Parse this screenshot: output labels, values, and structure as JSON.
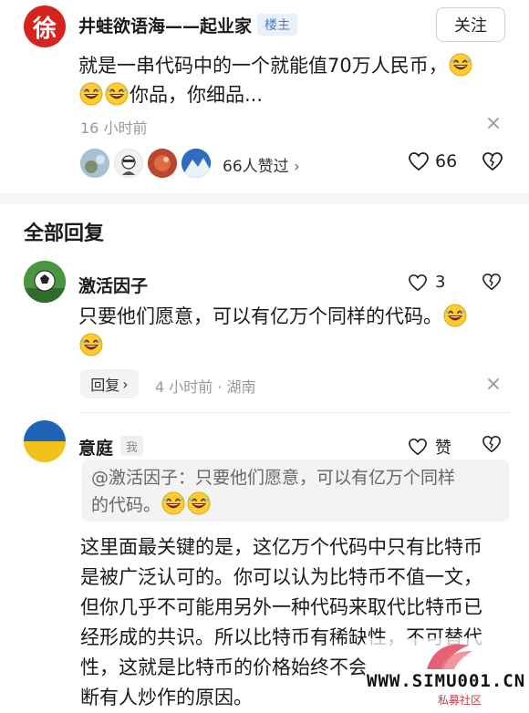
{
  "post": {
    "author": "井蛙欲语海——起业家",
    "avatar_char": "徐",
    "op_badge": "楼主",
    "follow_label": "关注",
    "text_line1": "就是一串代码中的一个就能值70万人民币，",
    "text_line2_suffix": "你品，你细品...",
    "time": "16 小时前",
    "likers_text": "66人赞过",
    "like_count": "66"
  },
  "section_title": "全部回复",
  "comments": [
    {
      "author": "激活因子",
      "like_count": "3",
      "text": "只要他们愿意，可以有亿万个同样的代码。",
      "reply_label": "回复",
      "meta": "4 小时前 · 湖南"
    },
    {
      "author": "意庭",
      "badge": "我",
      "like_label": "赞",
      "quote_line1": "@激活因子：只要他们愿意，可以有亿万个同样",
      "quote_line2": "的代码。",
      "lines": [
        "这里面最关键的是，这亿万个代码中只有比特币",
        "是被广泛认可的。你可以认为比特币不值一文，",
        "但你几乎不可能用另外一种代码来取代比特币已",
        "经形成的共识。所以比特币有稀缺性，不可替代",
        "性，这就是比特币的价格始终不会",
        "断有人炒作的原因。"
      ]
    }
  ],
  "watermark": {
    "url": "WWW.SIMU001.CN",
    "name": "私募社区"
  },
  "colors": {
    "avatar_red": "#d7231d",
    "accent_blue": "#4a7fbf",
    "watermark_red": "#e0455a"
  }
}
